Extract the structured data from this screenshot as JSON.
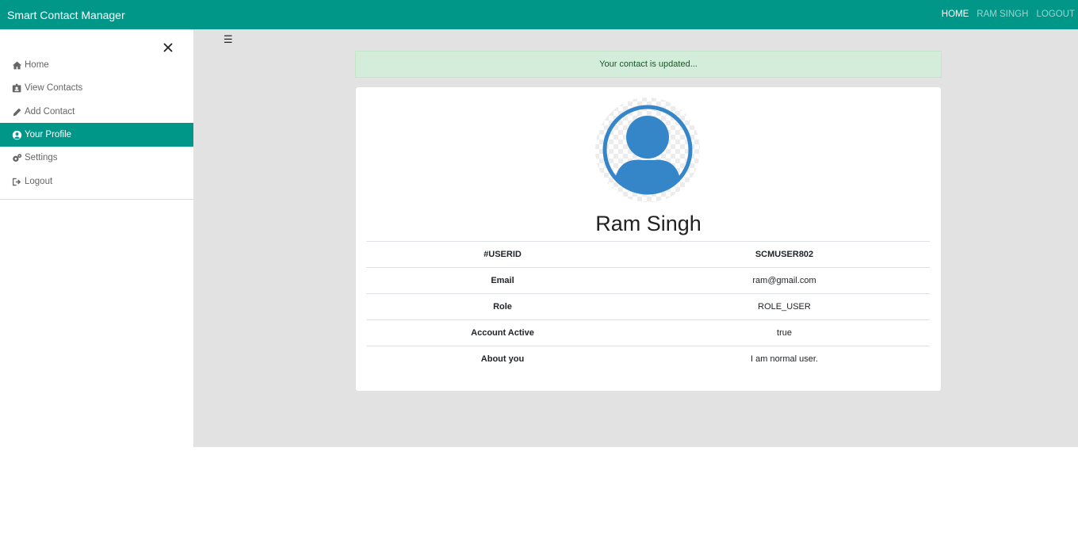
{
  "app": {
    "title": "Smart Contact Manager"
  },
  "nav": {
    "home": "HOME",
    "user": "RAM SINGH",
    "logout": "LOGOUT"
  },
  "sidebar": {
    "items": [
      {
        "label": "Home",
        "icon": "home-icon"
      },
      {
        "label": "View Contacts",
        "icon": "id-card-icon"
      },
      {
        "label": "Add Contact",
        "icon": "pencil-icon"
      },
      {
        "label": "Your Profile",
        "icon": "user-circle-icon"
      },
      {
        "label": "Settings",
        "icon": "gears-icon"
      },
      {
        "label": "Logout",
        "icon": "sign-out-icon"
      }
    ]
  },
  "alert": {
    "message": "Your contact is updated..."
  },
  "profile": {
    "name": "Ram Singh",
    "rows": [
      {
        "key": "#USERID",
        "value": "SCMUSER802"
      },
      {
        "key": "Email",
        "value": "ram@gmail.com"
      },
      {
        "key": "Role",
        "value": "ROLE_USER"
      },
      {
        "key": "Account Active",
        "value": "true"
      },
      {
        "key": "About you",
        "value": "I am normal user."
      }
    ]
  },
  "colors": {
    "primary": "#009688",
    "alert_bg": "#d4edda",
    "avatar": "#3586c9"
  }
}
